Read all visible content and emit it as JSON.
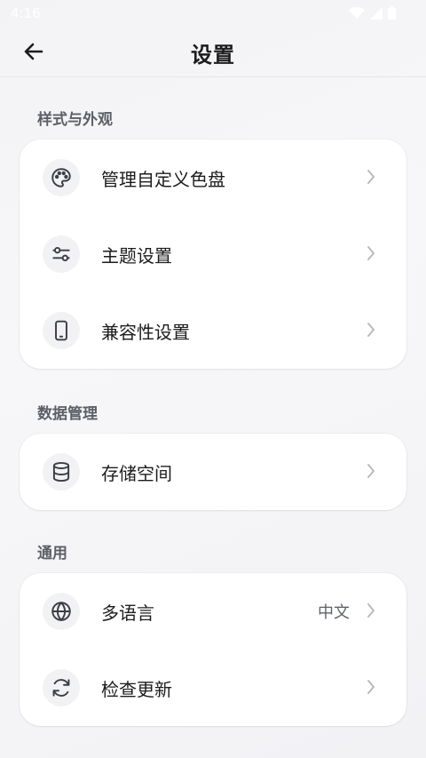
{
  "status": {
    "time": "4:16"
  },
  "header": {
    "title": "设置"
  },
  "sections": [
    {
      "label": "样式与外观",
      "items": [
        {
          "label": "管理自定义色盘",
          "icon": "palette-icon"
        },
        {
          "label": "主题设置",
          "icon": "sliders-icon"
        },
        {
          "label": "兼容性设置",
          "icon": "phone-icon"
        }
      ]
    },
    {
      "label": "数据管理",
      "items": [
        {
          "label": "存储空间",
          "icon": "database-icon"
        }
      ]
    },
    {
      "label": "通用",
      "items": [
        {
          "label": "多语言",
          "value": "中文",
          "icon": "globe-icon"
        },
        {
          "label": "检查更新",
          "icon": "refresh-icon"
        }
      ]
    }
  ]
}
